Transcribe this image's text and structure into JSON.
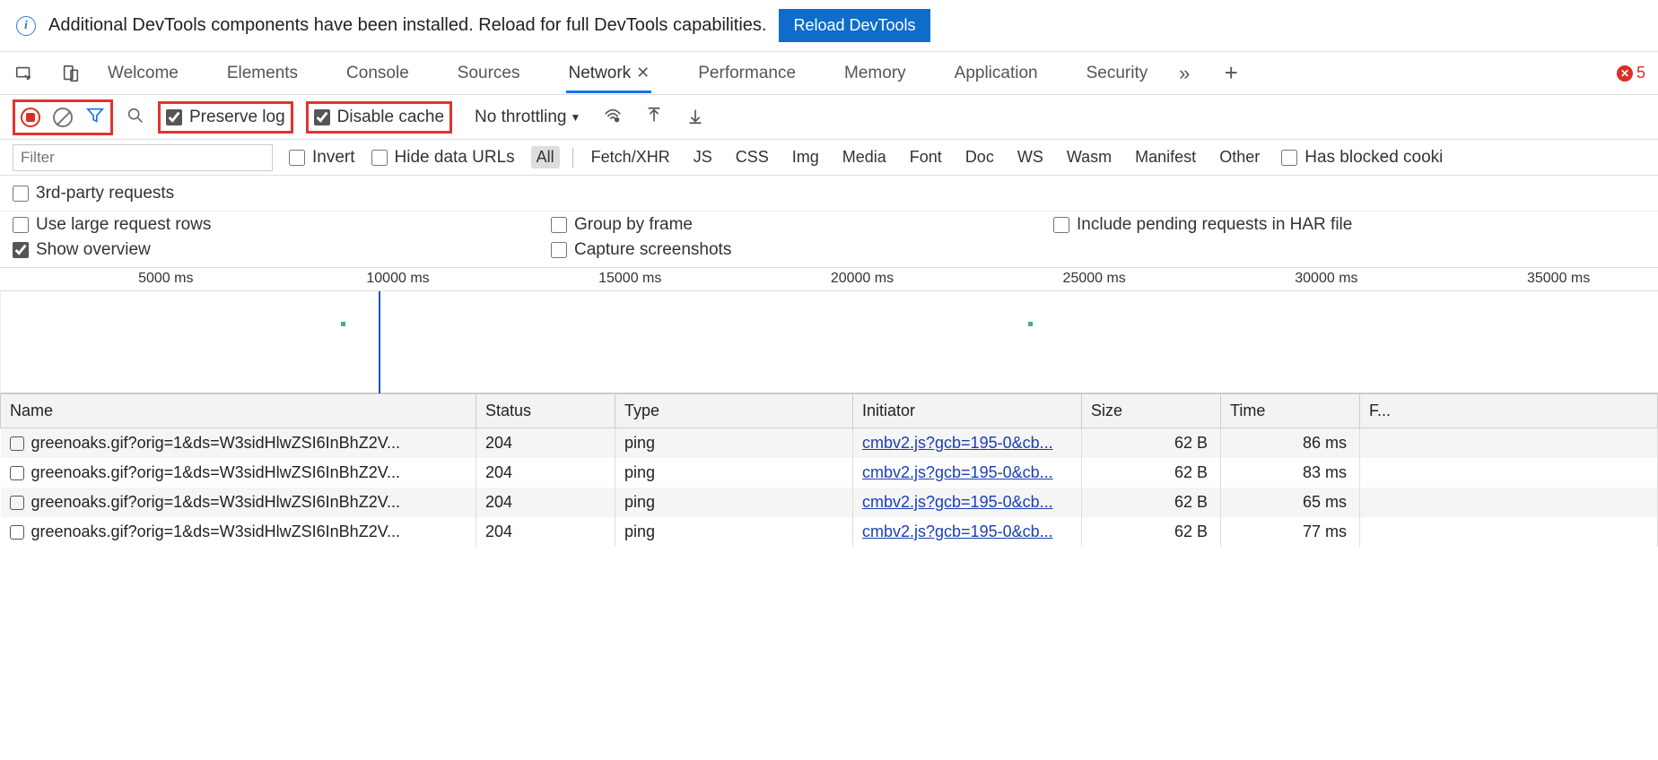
{
  "infoBar": {
    "text": "Additional DevTools components have been installed. Reload for full DevTools capabilities.",
    "button": "Reload DevTools"
  },
  "tabs": [
    "Welcome",
    "Elements",
    "Console",
    "Sources",
    "Network",
    "Performance",
    "Memory",
    "Application",
    "Security"
  ],
  "activeTab": "Network",
  "errorCount": "5",
  "toolbar": {
    "preserveLog": "Preserve log",
    "disableCache": "Disable cache",
    "throttling": "No throttling"
  },
  "filterRow": {
    "placeholder": "Filter",
    "invert": "Invert",
    "hideDataUrls": "Hide data URLs",
    "types": [
      "All",
      "Fetch/XHR",
      "JS",
      "CSS",
      "Img",
      "Media",
      "Font",
      "Doc",
      "WS",
      "Wasm",
      "Manifest",
      "Other"
    ],
    "blockedCookies": "Has blocked cooki"
  },
  "opts": {
    "thirdParty": "3rd-party requests",
    "largeRows": "Use large request rows",
    "groupByFrame": "Group by frame",
    "includePending": "Include pending requests in HAR file",
    "showOverview": "Show overview",
    "captureScreenshots": "Capture screenshots"
  },
  "timeline": {
    "labels": [
      "5000 ms",
      "10000 ms",
      "15000 ms",
      "20000 ms",
      "25000 ms",
      "30000 ms",
      "35000 ms"
    ],
    "positions": [
      10,
      24,
      38,
      52,
      66,
      80,
      94
    ],
    "cursorPos": 22.8
  },
  "table": {
    "headers": [
      "Name",
      "Status",
      "Type",
      "Initiator",
      "Size",
      "Time",
      "F..."
    ],
    "rows": [
      {
        "name": "greenoaks.gif?orig=1&ds=W3sidHlwZSI6InBhZ2V...",
        "status": "204",
        "type": "ping",
        "initiator": "cmbv2.js?gcb=195-0&cb...",
        "size": "62 B",
        "time": "86 ms"
      },
      {
        "name": "greenoaks.gif?orig=1&ds=W3sidHlwZSI6InBhZ2V...",
        "status": "204",
        "type": "ping",
        "initiator": "cmbv2.js?gcb=195-0&cb...",
        "size": "62 B",
        "time": "83 ms"
      },
      {
        "name": "greenoaks.gif?orig=1&ds=W3sidHlwZSI6InBhZ2V...",
        "status": "204",
        "type": "ping",
        "initiator": "cmbv2.js?gcb=195-0&cb...",
        "size": "62 B",
        "time": "65 ms"
      },
      {
        "name": "greenoaks.gif?orig=1&ds=W3sidHlwZSI6InBhZ2V...",
        "status": "204",
        "type": "ping",
        "initiator": "cmbv2.js?gcb=195-0&cb...",
        "size": "62 B",
        "time": "77 ms"
      }
    ]
  }
}
